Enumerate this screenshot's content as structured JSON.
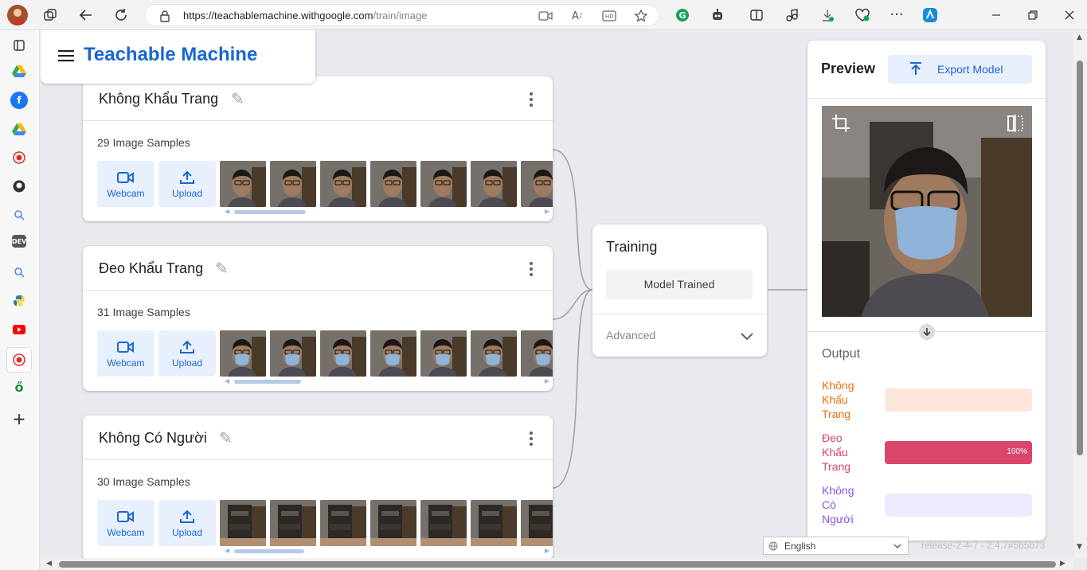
{
  "browser": {
    "url_domain": "https://teachablemachine.withgoogle.com",
    "url_path": "/train/image",
    "icons": [
      "avatar",
      "workspaces-icon",
      "back-icon",
      "reload-icon",
      "lock-icon",
      "camera-icon",
      "read-aloud-icon",
      "hd-icon",
      "favorite-icon",
      "grammarly-icon",
      "extension-icon",
      "split-screen-icon",
      "music-icon",
      "downloads-icon",
      "heart-pulse-icon",
      "more-icon",
      "copilot-icon",
      "minimize-icon",
      "restore-icon",
      "close-icon"
    ]
  },
  "sidebar": {
    "items": [
      "tabs-icon",
      "drive-icon",
      "facebook-icon",
      "drive-icon",
      "record-icon",
      "github-icon",
      "search-icon",
      "dev-icon",
      "search-icon",
      "python-icon",
      "youtube-icon",
      "record-icon",
      "green-app-icon",
      "add-icon"
    ]
  },
  "app": {
    "title": "Teachable Machine"
  },
  "classes": [
    {
      "name": "Không Khẩu Trang",
      "samples": "29 Image Samples",
      "webcam": "Webcam",
      "upload": "Upload",
      "masked": false
    },
    {
      "name": "Đeo Khẩu Trang",
      "samples": "31 Image Samples",
      "webcam": "Webcam",
      "upload": "Upload",
      "masked": true
    },
    {
      "name": "Không Có Người",
      "samples": "30 Image Samples",
      "webcam": "Webcam",
      "upload": "Upload",
      "masked": false
    }
  ],
  "training": {
    "title": "Training",
    "button": "Model Trained",
    "advanced": "Advanced"
  },
  "preview": {
    "title": "Preview",
    "export": "Export Model",
    "output_title": "Output",
    "outputs": [
      {
        "line1": "Không",
        "line2": "Khẩu",
        "line3": "Trang",
        "percent": 0,
        "pct_text": "",
        "color": "#e8710a",
        "track": "#fde7da"
      },
      {
        "line1": "Đeo",
        "line2": "Khẩu",
        "line3": "Trang",
        "percent": 100,
        "pct_text": "100%",
        "color": "#d9466a",
        "track": "#fbdce4"
      },
      {
        "line1": "Không",
        "line2": "Có",
        "line3": "Người",
        "percent": 0,
        "pct_text": "",
        "color": "#8c54e6",
        "track": "#efeafd"
      }
    ]
  },
  "footer": {
    "language": "English",
    "release": "release-2-4-7 - 2.4.7#5b5b73"
  },
  "colors": {
    "brand_blue": "#1967d2",
    "accent_light": "#e8f0fe"
  }
}
